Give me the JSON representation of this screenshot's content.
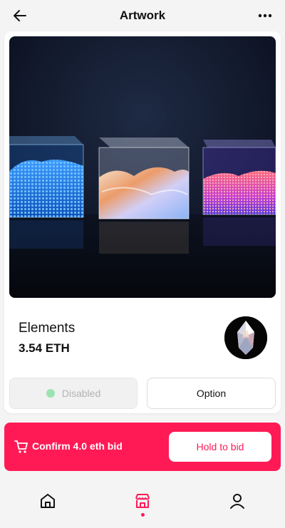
{
  "header": {
    "title": "Artwork",
    "back_icon": "arrow-left-icon",
    "more_icon": "more-horizontal-icon"
  },
  "artwork": {
    "name": "Elements",
    "price": "3.54 ETH",
    "image": "glass-cubes-artwork",
    "avatar": "crystal-avatar"
  },
  "actions": {
    "disabled_label": "Disabled",
    "option_label": "Option"
  },
  "bid": {
    "confirm_label": "Confirm 4.0 eth bid",
    "hold_label": "Hold to bid",
    "icon": "cart-icon"
  },
  "tabbar": {
    "items": [
      {
        "icon": "home-icon",
        "active": false
      },
      {
        "icon": "store-icon",
        "active": true
      },
      {
        "icon": "user-icon",
        "active": false
      }
    ]
  },
  "colors": {
    "accent": "#ff1a56",
    "background": "#f4f4f4",
    "card": "#ffffff",
    "disabled_dot": "#9be3b0"
  }
}
